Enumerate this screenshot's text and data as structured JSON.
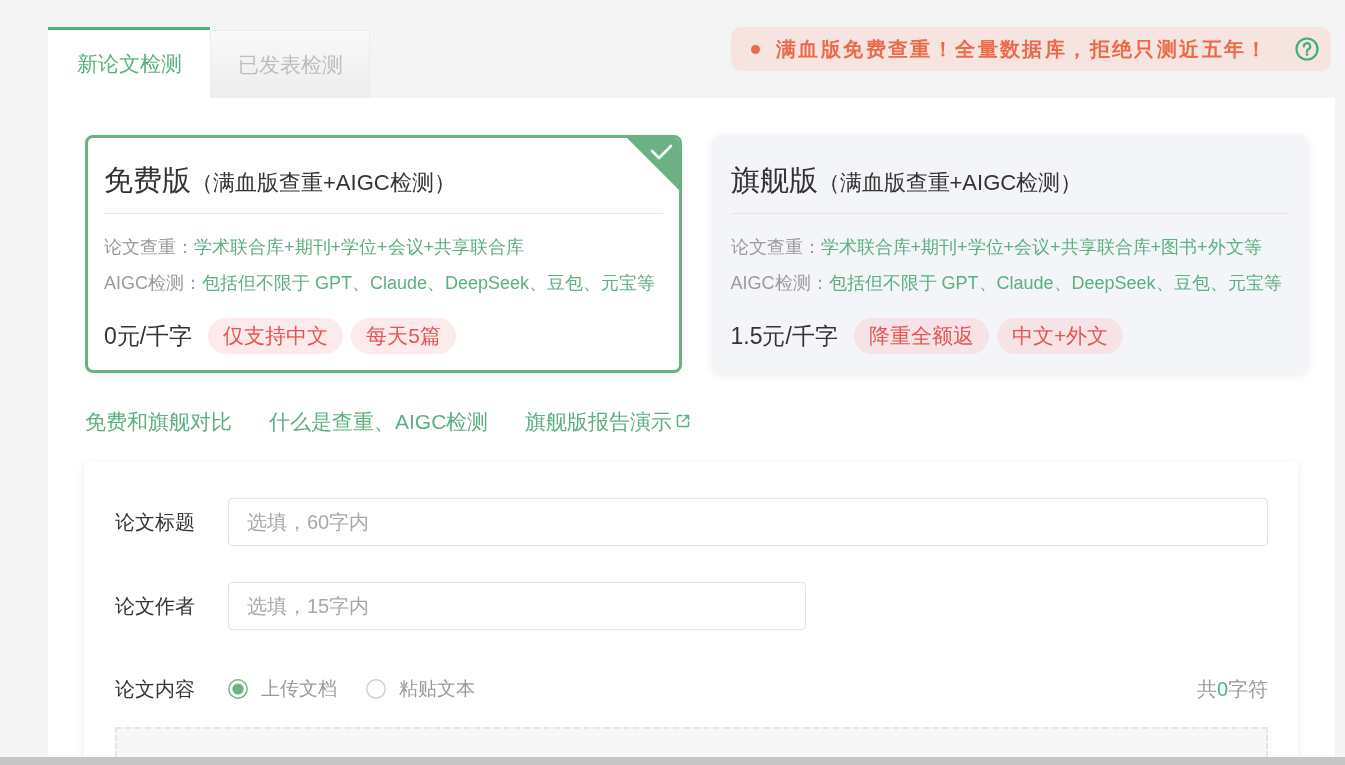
{
  "tabs": [
    {
      "label": "新论文检测",
      "selected": true
    },
    {
      "label": "已发表检测",
      "selected": false
    }
  ],
  "notice": {
    "text": "满血版免费查重！全量数据库，拒绝只测近五年！"
  },
  "plans": [
    {
      "name": "免费版",
      "subtitle": "（满血版查重+AIGC检测）",
      "selected": true,
      "features": [
        {
          "label": "论文查重：",
          "value": "学术联合库+期刊+学位+会议+共享联合库"
        },
        {
          "label": "AIGC检测：",
          "value": "包括但不限于 GPT、Claude、DeepSeek、豆包、元宝等"
        }
      ],
      "price": "0元/千字",
      "tags": [
        "仅支持中文",
        "每天5篇"
      ]
    },
    {
      "name": "旗舰版",
      "subtitle": "（满血版查重+AIGC检测）",
      "selected": false,
      "features": [
        {
          "label": "论文查重：",
          "value": "学术联合库+期刊+学位+会议+共享联合库+图书+外文等"
        },
        {
          "label": "AIGC检测：",
          "value": "包括但不限于 GPT、Claude、DeepSeek、豆包、元宝等"
        }
      ],
      "price": "1.5元/千字",
      "tags": [
        "降重全额返",
        "中文+外文"
      ]
    }
  ],
  "links": [
    {
      "text": "免费和旗舰对比",
      "external": false
    },
    {
      "text": "什么是查重、AIGC检测",
      "external": false
    },
    {
      "text": "旗舰版报告演示",
      "external": true
    }
  ],
  "form": {
    "fields": [
      {
        "label": "论文标题",
        "placeholder": "选填，60字内"
      },
      {
        "label": "论文作者",
        "placeholder": "选填，15字内"
      }
    ],
    "content": {
      "label": "论文内容",
      "options": [
        {
          "label": "上传文档",
          "selected": true
        },
        {
          "label": "粘贴文本",
          "selected": false
        }
      ],
      "count": {
        "prefix": "共",
        "value": "0",
        "suffix": "字符"
      }
    }
  }
}
